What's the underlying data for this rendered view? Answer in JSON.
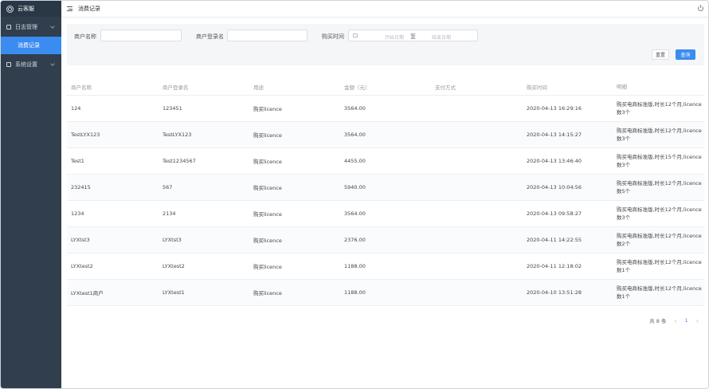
{
  "sidebar": {
    "brand": "云客服",
    "menus": [
      {
        "label": "日志管理",
        "children": [
          "消费记录"
        ]
      },
      {
        "label": "系统设置"
      }
    ]
  },
  "header": {
    "title": "消费记录"
  },
  "search": {
    "merchant_name_label": "商户名称",
    "merchant_login_label": "商户登录名",
    "purchase_time_label": "购买时间",
    "date_start_placeholder": "开始日期",
    "date_sep": "至",
    "date_end_placeholder": "结束日期",
    "reset_label": "重置",
    "query_label": "查询"
  },
  "table": {
    "columns": [
      "商户名称",
      "商户登录名",
      "用途",
      "金额（元）",
      "支付方式",
      "购买时间",
      "明细"
    ],
    "rows": [
      {
        "name": "124",
        "login": "123451",
        "use": "购买licence",
        "amount": "3564.00",
        "pay": "",
        "time": "2020-04-13 16:29:16",
        "detail": "购买电商标准版,时长12个月,licence数3个"
      },
      {
        "name": "TestLYX123",
        "login": "TestLYX123",
        "use": "购买licence",
        "amount": "3564.00",
        "pay": "",
        "time": "2020-04-13 14:15:27",
        "detail": "购买电商标准版,时长12个月,licence数3个"
      },
      {
        "name": "Test1",
        "login": "Test1234567",
        "use": "购买licence",
        "amount": "4455.00",
        "pay": "",
        "time": "2020-04-13 13:46:40",
        "detail": "购买电商标准版,时长15个月,licence数3个"
      },
      {
        "name": "232415",
        "login": "567",
        "use": "购买licence",
        "amount": "5940.00",
        "pay": "",
        "time": "2020-04-13 10:04:56",
        "detail": "购买电商标准版,时长12个月,licence数5个"
      },
      {
        "name": "1234",
        "login": "2134",
        "use": "购买licence",
        "amount": "3564.00",
        "pay": "",
        "time": "2020-04-13 09:58:27",
        "detail": "购买电商标准版,时长12个月,licence数3个"
      },
      {
        "name": "LYXtst3",
        "login": "LYXtst3",
        "use": "购买licence",
        "amount": "2376.00",
        "pay": "",
        "time": "2020-04-11 14:22:55",
        "detail": "购买电商标准版,时长12个月,licence数2个"
      },
      {
        "name": "LYXtest2",
        "login": "LYXtest2",
        "use": "购买licence",
        "amount": "1188.00",
        "pay": "",
        "time": "2020-04-11 12:18:02",
        "detail": "购买电商标准版,时长12个月,licence数1个"
      },
      {
        "name": "LYXtest1商户",
        "login": "LYXtest1",
        "use": "购买licence",
        "amount": "1188.00",
        "pay": "",
        "time": "2020-04-10 13:51:28",
        "detail": "购买电商标准版,时长12个月,licence数1个"
      }
    ]
  },
  "pagination": {
    "total_label": "共 8 条",
    "current_page": "1",
    "prev_icon": "‹",
    "next_icon": "›"
  },
  "colors": {
    "sidebar_bg": "#303e4d",
    "accent": "#3b8cf0"
  }
}
